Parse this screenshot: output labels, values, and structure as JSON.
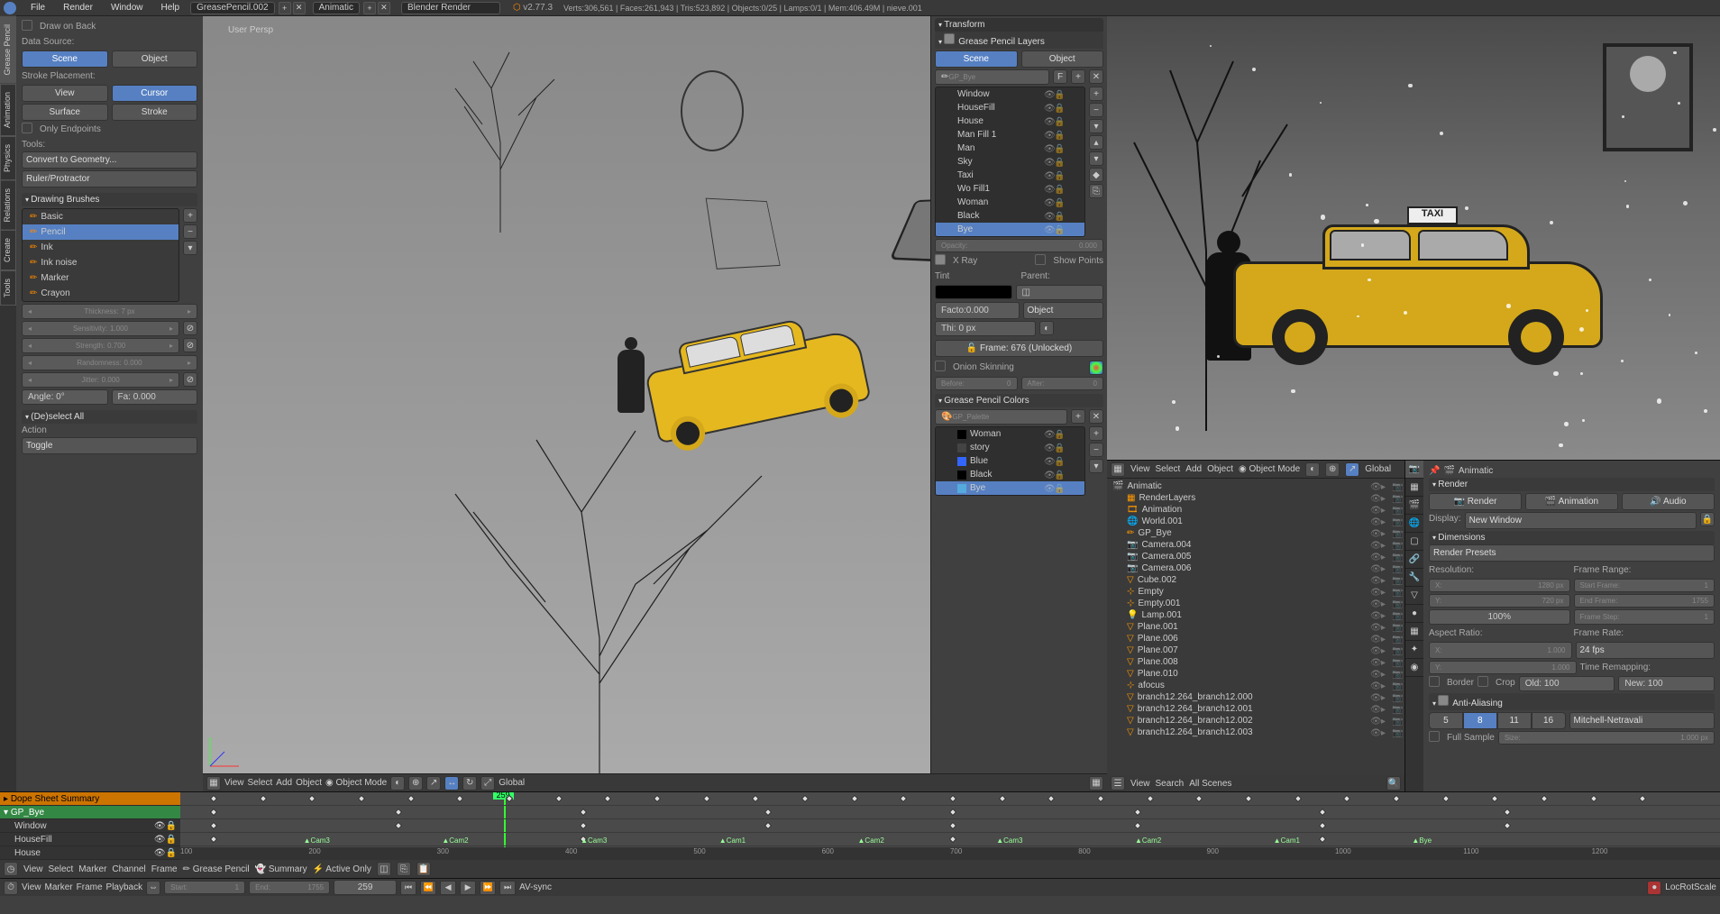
{
  "menubar": {
    "items": [
      "File",
      "Render",
      "Window",
      "Help"
    ],
    "scene_name": "GreasePencil.002",
    "layout_name": "Animatic",
    "engine": "Blender Render",
    "version": "v2.77.3",
    "stats": "Verts:306,561 | Faces:261,943 | Tris:523,892 | Objects:0/25 | Lamps:0/1 | Mem:406.49M | nieve.001"
  },
  "toolpanel": {
    "tabs": [
      "Grease Pencil",
      "Animation",
      "Physics",
      "Relations",
      "Create",
      "Tools"
    ],
    "draw_on_back": "Draw on Back",
    "data_source_label": "Data Source:",
    "data_source": {
      "scene": "Scene",
      "object": "Object"
    },
    "stroke_placement_label": "Stroke Placement:",
    "stroke_placement": {
      "view": "View",
      "cursor": "Cursor",
      "surface": "Surface",
      "stroke": "Stroke"
    },
    "only_endpoints": "Only Endpoints",
    "tools_label": "Tools:",
    "convert": "Convert to Geometry...",
    "ruler": "Ruler/Protractor",
    "drawing_brushes": "Drawing Brushes",
    "brushes": [
      "Basic",
      "Pencil",
      "Ink",
      "Ink noise",
      "Marker",
      "Crayon"
    ],
    "brush_selected": 1,
    "thickness_label": "Thickness:",
    "thickness_val": "7 px",
    "sensitivity_label": "Sensitivity:",
    "sensitivity_val": "1.000",
    "strength_label": "Strength:",
    "strength_val": "0.700",
    "randomness_label": "Randomness:",
    "randomness_val": "0.000",
    "jitter_label": "Jitter:",
    "jitter_val": "0.000",
    "angle_label": "Angle: 0°",
    "angle_fac": "Fa: 0.000",
    "deselect": "(De)select All",
    "action_label": "Action",
    "toggle": "Toggle"
  },
  "viewport": {
    "persp": "User Persp",
    "header": {
      "menus": [
        "View",
        "Select",
        "Add",
        "Object"
      ],
      "mode": "Object Mode",
      "shading": "Global"
    }
  },
  "npanel": {
    "transform": "Transform",
    "gp_layers": "Grease Pencil Layers",
    "data_source": {
      "scene": "Scene",
      "object": "Object"
    },
    "gp_name": "GP_Bye",
    "layers": [
      "Window",
      "HouseFill",
      "House",
      "Man Fill 1",
      "Man",
      "Sky",
      "Taxi",
      "Wo Fill1",
      "Woman",
      "Black",
      "Bye"
    ],
    "layer_selected": 10,
    "opacity_label": "Opacity:",
    "opacity_val": "0.000",
    "xray": "X Ray",
    "show_points": "Show Points",
    "tint": "Tint",
    "parent": "Parent:",
    "factor_label": "Facto:0.000",
    "parent_type": "Object",
    "thi": "Thi: 0 px",
    "frame_lock": "Frame: 676 (Unlocked)",
    "onion": "Onion Skinning",
    "before": "Before:",
    "before_val": "0",
    "after": "After:",
    "after_val": "0",
    "gp_colors": "Grease Pencil Colors",
    "palette": "GP_Palette",
    "colors": [
      "Woman",
      "story",
      "Blue",
      "Black",
      "Bye"
    ],
    "color_selected": 4
  },
  "preview": {
    "taxi_sign": "TAXI"
  },
  "outliner": {
    "header": {
      "menus": [
        "View",
        "Select",
        "Add",
        "Object"
      ],
      "mode": "Object Mode",
      "orient": "Global"
    },
    "items": [
      {
        "n": "Animatic",
        "d": 0,
        "t": "scene"
      },
      {
        "n": "RenderLayers",
        "d": 1,
        "t": "rl"
      },
      {
        "n": "Animation",
        "d": 1,
        "t": "anim"
      },
      {
        "n": "World.001",
        "d": 1,
        "t": "world"
      },
      {
        "n": "GP_Bye",
        "d": 1,
        "t": "gp"
      },
      {
        "n": "Camera.004",
        "d": 1,
        "t": "cam"
      },
      {
        "n": "Camera.005",
        "d": 1,
        "t": "cam"
      },
      {
        "n": "Camera.006",
        "d": 1,
        "t": "cam"
      },
      {
        "n": "Cube.002",
        "d": 1,
        "t": "mesh"
      },
      {
        "n": "Empty",
        "d": 1,
        "t": "empty"
      },
      {
        "n": "Empty.001",
        "d": 1,
        "t": "empty"
      },
      {
        "n": "Lamp.001",
        "d": 1,
        "t": "lamp"
      },
      {
        "n": "Plane.001",
        "d": 1,
        "t": "mesh"
      },
      {
        "n": "Plane.006",
        "d": 1,
        "t": "mesh"
      },
      {
        "n": "Plane.007",
        "d": 1,
        "t": "mesh"
      },
      {
        "n": "Plane.008",
        "d": 1,
        "t": "mesh"
      },
      {
        "n": "Plane.010",
        "d": 1,
        "t": "mesh"
      },
      {
        "n": "afocus",
        "d": 1,
        "t": "empty"
      },
      {
        "n": "branch12.264_branch12.000",
        "d": 1,
        "t": "mesh"
      },
      {
        "n": "branch12.264_branch12.001",
        "d": 1,
        "t": "mesh"
      },
      {
        "n": "branch12.264_branch12.002",
        "d": 1,
        "t": "mesh"
      },
      {
        "n": "branch12.264_branch12.003",
        "d": 1,
        "t": "mesh"
      }
    ],
    "footer": {
      "view": "View",
      "search": "Search",
      "filter": "All Scenes"
    }
  },
  "properties": {
    "breadcrumb": "Animatic",
    "render": "Render",
    "render_btn": "Render",
    "anim_btn": "Animation",
    "audio_btn": "Audio",
    "display_label": "Display:",
    "display_val": "New Window",
    "dimensions": "Dimensions",
    "presets": "Render Presets",
    "resolution": "Resolution:",
    "frame_range": "Frame Range:",
    "x_label": "X:",
    "x_val": "1280 px",
    "start_label": "Start Frame:",
    "start_val": "1",
    "y_label": "Y:",
    "y_val": "720 px",
    "end_label": "End Frame:",
    "end_val": "1755",
    "pct": "100%",
    "step_label": "Frame Step:",
    "step_val": "1",
    "aspect": "Aspect Ratio:",
    "framerate": "Frame Rate:",
    "ax_val": "1.000",
    "fps": "24 fps",
    "ay_val": "1.000",
    "remap": "Time Remapping:",
    "border": "Border",
    "crop": "Crop",
    "old": "Old: 100",
    "new": "New: 100",
    "aa": "Anti-Aliasing",
    "samples": [
      "5",
      "8",
      "11",
      "16"
    ],
    "sample_sel": 1,
    "filter": "Mitchell-Netravali",
    "full_sample": "Full Sample",
    "size_label": "Size:",
    "size_val": "1.000 px"
  },
  "dopesheet": {
    "summary": "Dope Sheet Summary",
    "gp_row": "GP_Bye",
    "channels": [
      "Window",
      "HouseFill",
      "House"
    ],
    "cams": [
      "Cam3",
      "Cam2",
      "Cam3",
      "Cam1",
      "Cam2",
      "Cam3",
      "Cam2",
      "Cam1",
      "Bye"
    ],
    "header": {
      "menus": [
        "View",
        "Select",
        "Marker",
        "Channel",
        "Frame"
      ],
      "mode": "Grease Pencil",
      "summary": "Summary",
      "active": "Active Only"
    },
    "ruler": [
      100,
      200,
      300,
      400,
      500,
      600,
      700,
      800,
      900,
      1000,
      1100,
      1200
    ],
    "playhead": 259
  },
  "timeline": {
    "menus": [
      "View",
      "Marker",
      "Frame",
      "Playback"
    ],
    "start_label": "Start:",
    "start": "1",
    "end_label": "End:",
    "end": "1755",
    "current": "259",
    "sync": "AV-sync",
    "keying": "LocRotScale"
  }
}
